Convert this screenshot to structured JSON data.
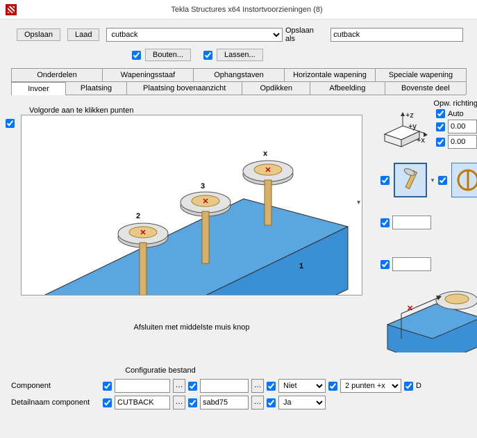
{
  "window": {
    "title": "Tekla Structures x64  Instortvoorzieningen (8)"
  },
  "toolbar": {
    "save": "Opslaan",
    "load": "Laad",
    "preset_selected": "cutback",
    "save_as": "Opslaan als",
    "save_as_value": "cutback",
    "bouten": "Bouten...",
    "lassen": "Lassen..."
  },
  "tabs1": {
    "onderdelen": "Onderdelen",
    "wapeningsstaaf": "Wapeningsstaaf",
    "ophangstaven": "Ophangstaven",
    "horizontale": "Horizontale wapening",
    "speciale": "Speciale wapening"
  },
  "tabs2": {
    "invoer": "Invoer",
    "plaatsing": "Plaatsing",
    "pba": "Plaatsing bovenaanzicht",
    "opdikken": "Opdikken",
    "afbeelding": "Afbeelding",
    "bovenste": "Bovenste deel"
  },
  "main": {
    "volgorde": "Volgorde aan te klikken punten",
    "caption": "Afsluiten met middelste muis knop",
    "labels": {
      "one": "1",
      "two": "2",
      "three": "3",
      "x": "x"
    }
  },
  "side": {
    "opw": "Opw. richting",
    "auto": "Auto",
    "val1": "0.00",
    "val2": "0.00",
    "axis_z": "+z",
    "axis_x": "+x",
    "axis_y": "+y",
    "empty1": "",
    "empty2": "",
    "D": "D"
  },
  "config": {
    "title": "Configuratie bestand",
    "component": "Component",
    "detailnaam": "Detailnaam component",
    "cutback": "CUTBACK",
    "sabd": "sabd75",
    "niet": "Niet",
    "ja": "Ja",
    "punten": "2 punten +x",
    "blank": ""
  }
}
